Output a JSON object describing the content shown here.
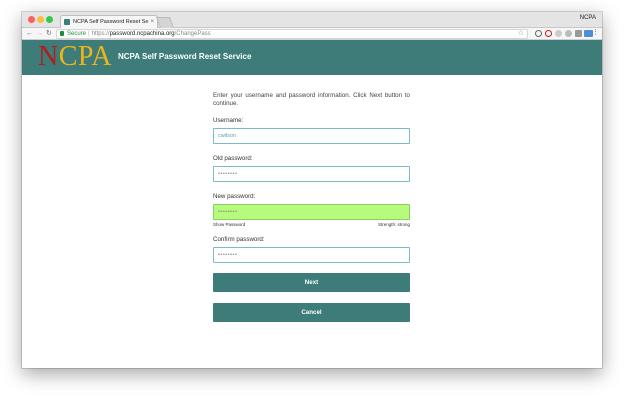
{
  "browser": {
    "tab_title": "NCPA Self Password Reset Se",
    "profile_name": "NCPA",
    "secure_label": "Secure",
    "url_scheme": "https://",
    "url_host": "password.ncpachina.org",
    "url_path": "/ChangePass"
  },
  "header": {
    "logo_n": "N",
    "logo_rest": "CPA",
    "title": "NCPA Self Password Reset Service"
  },
  "form": {
    "intro": "Enter your username and password information. Click Next button to continue.",
    "username": {
      "label": "Username:",
      "value": "cwilson"
    },
    "old_password": {
      "label": "Old password:",
      "value": "••••••••"
    },
    "new_password": {
      "label": "New password:",
      "value": "••••••••",
      "show_label": "Show Password",
      "strength": "Strength: strong"
    },
    "confirm_password": {
      "label": "Confirm password:",
      "value": "••••••••"
    },
    "next_label": "Next",
    "cancel_label": "Cancel"
  },
  "colors": {
    "brand_teal": "#3d7c78",
    "strong_field": "#b6fb7c",
    "field_border": "#7bbac6"
  }
}
